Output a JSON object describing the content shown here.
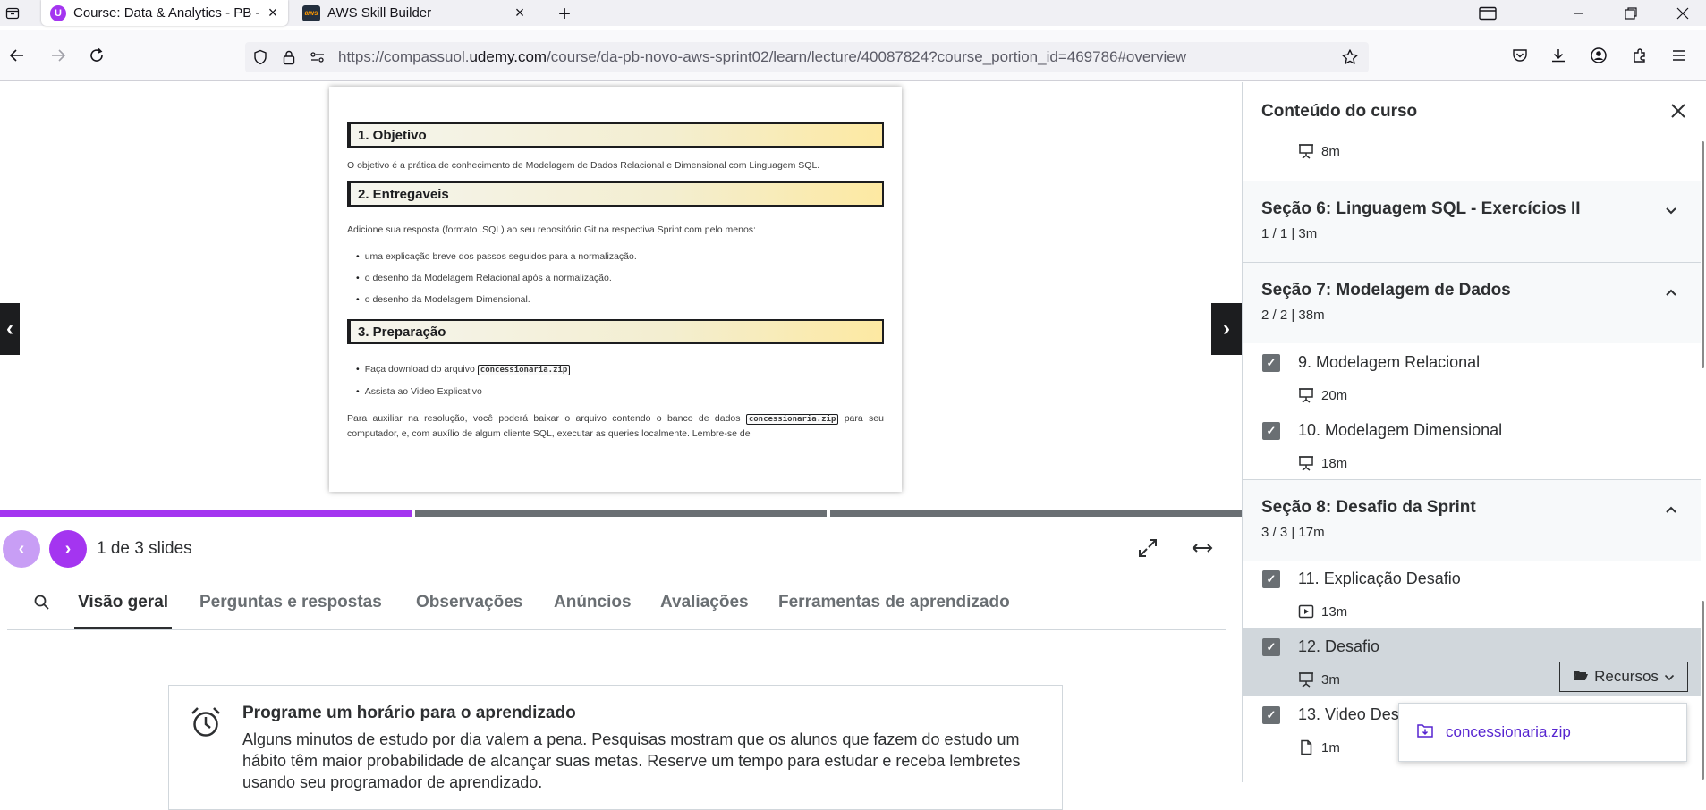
{
  "browser": {
    "tabs": [
      {
        "title": "Course: Data & Analytics - PB -",
        "active": true,
        "favicon": "udemy-icon"
      },
      {
        "title": "AWS Skill Builder",
        "active": false,
        "favicon": "aws-icon"
      }
    ],
    "url_prefix": "https://compassuol.",
    "url_domain": "udemy.com",
    "url_path": "/course/da-pb-novo-aws-sprint02/learn/lecture/40087824?course_portion_id=469786#overview"
  },
  "slide": {
    "h1": "1. Objetivo",
    "p1": "O objetivo é a prática de conhecimento de Modelagem de Dados Relacional e Dimensional com Linguagem SQL.",
    "h2": "2. Entregaveis",
    "p2": "Adicione sua resposta (formato .SQL) ao seu repositório Git na respectiva Sprint com pelo menos:",
    "items2": [
      "uma explicação breve dos passos seguidos para a normalização.",
      "o desenho da Modelagem Relacional após a normalização.",
      "o desenho da Modelagem Dimensional."
    ],
    "h3": "3. Preparação",
    "item3a_prefix": "Faça download do arquivo",
    "code": "concessionaria.zip",
    "item3b": "Assista ao Video Explicativo",
    "p3_prefix": "Para auxiliar na resolução, você poderá baixar o arquivo contendo o banco de dados",
    "p3_suffix": "para seu computador, e, com auxílio de algum cliente SQL, executar as queries localmente. Lembre-se de"
  },
  "player": {
    "slide_count": "1 de 3 slides",
    "progress_segments": 3,
    "progress_done": 1
  },
  "course_tabs": [
    "Visão geral",
    "Perguntas e respostas",
    "Observações",
    "Anúncios",
    "Avaliações",
    "Ferramentas de aprendizado"
  ],
  "notice": {
    "title": "Programe um horário para o aprendizado",
    "text": "Alguns minutos de estudo por dia valem a pena. Pesquisas mostram que os alunos que fazem do estudo um hábito têm maior probabilidade de alcançar suas metas. Reserve um tempo para estudar e receba lembretes usando seu programador de aprendizado."
  },
  "sidebar": {
    "title": "Conteúdo do curso",
    "prev_duration": "8m",
    "sections": [
      {
        "title": "Seção 6: Linguagem SQL - Exercícios II",
        "meta": "1 / 1 | 3m",
        "expanded": false
      },
      {
        "title": "Seção 7: Modelagem de Dados",
        "meta": "2 / 2 | 38m",
        "expanded": true
      },
      {
        "title": "Seção 8: Desafio da Sprint",
        "meta": "3 / 3 | 17m",
        "expanded": true
      }
    ],
    "lectures": [
      {
        "title": "9. Modelagem Relacional",
        "duration": "20m",
        "icon": "slides-icon"
      },
      {
        "title": "10. Modelagem Dimensional",
        "duration": "18m",
        "icon": "slides-icon"
      },
      {
        "title": "11. Explicação Desafio",
        "duration": "13m",
        "icon": "video-icon"
      },
      {
        "title": "12. Desafio",
        "duration": "3m",
        "icon": "slides-icon"
      },
      {
        "title": "13. Video Desa",
        "duration": "1m",
        "icon": "file-icon"
      }
    ],
    "resources_label": "Recursos",
    "resource_file": "concessionaria.zip"
  },
  "colors": {
    "accent": "#a435f0",
    "link": "#5624d0",
    "current_bg": "#d1d7dc"
  }
}
